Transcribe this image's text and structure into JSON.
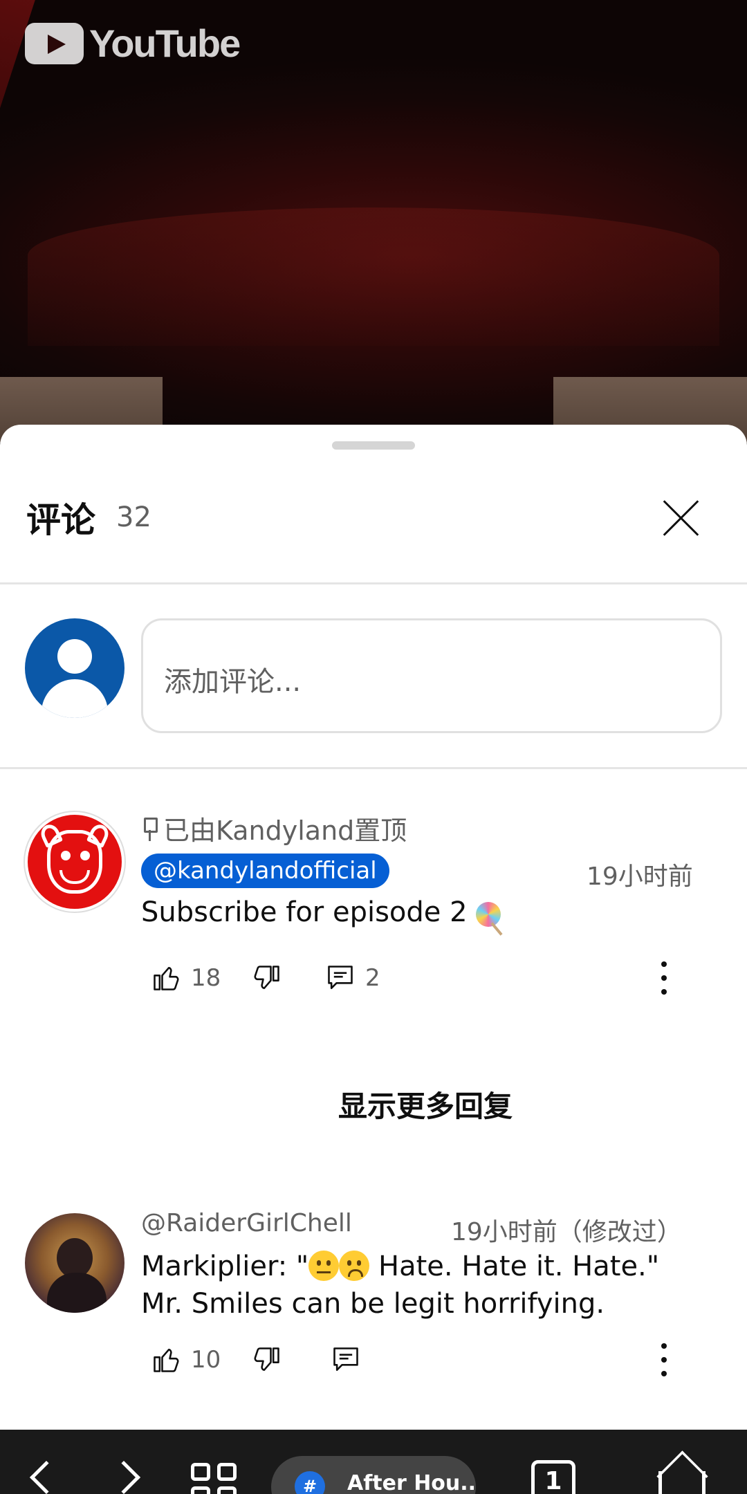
{
  "video": {
    "logo_text": "YouTube"
  },
  "comments_panel": {
    "title": "评论",
    "count": "32",
    "input_placeholder": "添加评论..."
  },
  "comments": [
    {
      "pinned_label": "已由Kandyland置顶",
      "handle": "@kandylandofficial",
      "time": "19小时前",
      "text": "Subscribe for episode 2",
      "emoji": "lollipop",
      "likes": "18",
      "replies": "2"
    },
    {
      "handle": "@RaiderGirlChell",
      "time": "19小时前（修改过）",
      "text_part1": "Markiplier: \"",
      "text_part2": " Hate. Hate it. Hate.\"",
      "text_line2": "Mr. Smiles can be legit horrifying.",
      "emojis": [
        "neutral-face",
        "worried-face"
      ],
      "likes": "10"
    }
  ],
  "show_more_replies": "显示更多回复",
  "browser_bar": {
    "tab_title": "After Hou...",
    "tab_icon": "#",
    "tabs_count": "1"
  }
}
